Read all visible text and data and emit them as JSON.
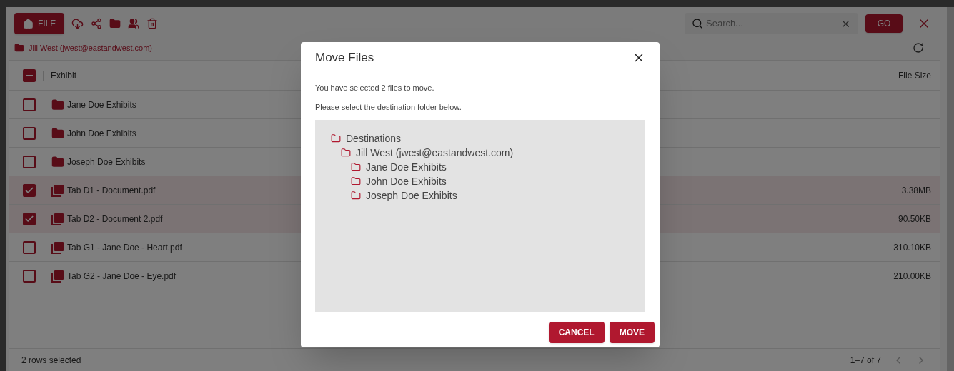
{
  "toolbar": {
    "file_button": "FILE",
    "search": {
      "placeholder": "Search..."
    },
    "go_button": "GO"
  },
  "breadcrumb": "Jill West (jwest@eastandwest.com)",
  "table": {
    "select_all_indeterminate": true,
    "columns": [
      "Exhibit",
      "File Size"
    ],
    "rows": [
      {
        "kind": "folder",
        "name": "Jane Doe Exhibits",
        "checked": false
      },
      {
        "kind": "folder",
        "name": "John Doe Exhibits",
        "checked": false
      },
      {
        "kind": "folder",
        "name": "Joseph Doe Exhibits",
        "checked": false
      },
      {
        "kind": "pdf",
        "name": "Tab D1 - Document.pdf",
        "size": "3.38MB",
        "checked": true
      },
      {
        "kind": "pdf",
        "name": "Tab D2 - Document 2.pdf",
        "size": "90.50KB",
        "checked": true
      },
      {
        "kind": "pdf",
        "name": "Tab G1 - Jane Doe - Heart.pdf",
        "size": "310.10KB",
        "checked": false
      },
      {
        "kind": "pdf",
        "name": "Tab G2 - Jane Doe - Eye.pdf",
        "size": "210.00KB",
        "checked": false
      }
    ]
  },
  "footer": {
    "selection": "2 rows selected",
    "range": "1–7 of 7"
  },
  "dialog": {
    "title": "Move Files",
    "lines": [
      "You have selected 2 files to move.",
      "Please select the destination folder below."
    ],
    "tree": [
      {
        "label": "Destinations",
        "children": [
          {
            "label": "Jill West (jwest@eastandwest.com)",
            "children": [
              {
                "label": "Jane Doe Exhibits"
              },
              {
                "label": "John Doe Exhibits"
              },
              {
                "label": "Joseph Doe Exhibits"
              }
            ]
          }
        ]
      }
    ],
    "buttons": [
      "CANCEL",
      "MOVE"
    ]
  }
}
